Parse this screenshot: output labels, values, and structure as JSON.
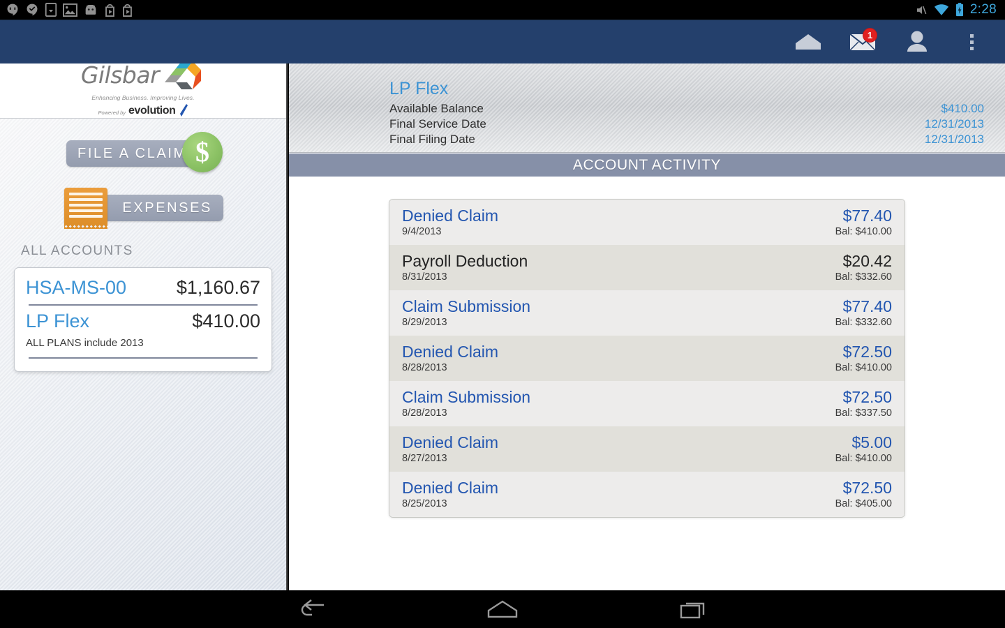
{
  "statusbar": {
    "clock": "2:28",
    "left_icons": [
      "hangouts-icon",
      "checkmark-message-icon",
      "download-icon",
      "photo-icon",
      "android-head-icon",
      "play-store-icon",
      "play-store-icon-2"
    ],
    "right_icons": [
      "mute-icon",
      "wifi-icon",
      "battery-charging-icon"
    ]
  },
  "appbar": {
    "background": "#24406c",
    "home_label": "home-icon",
    "messages_label": "messages-icon",
    "message_badge": "1",
    "profile_label": "profile-icon",
    "overflow_label": "overflow-menu-icon"
  },
  "sidebar": {
    "logo": {
      "brand": "Gilsbar",
      "tagline": "Enhancing Business. Improving Lives.",
      "powered_by": "Powered by",
      "platform": "evolution"
    },
    "file_claim_label": "FILE A CLAIM",
    "expenses_label": "EXPENSES",
    "all_accounts_label": "ALL ACCOUNTS",
    "accounts": [
      {
        "name": "HSA-MS-00",
        "balance": "$1,160.67"
      },
      {
        "name": "LP Flex",
        "balance": "$410.00"
      }
    ],
    "accounts_note": "ALL PLANS include 2013"
  },
  "account_header": {
    "title": "LP Flex",
    "rows": [
      {
        "label": "Available Balance",
        "value": "$410.00"
      },
      {
        "label": "Final Service Date",
        "value": "12/31/2013"
      },
      {
        "label": "Final Filing Date",
        "value": "12/31/2013"
      }
    ]
  },
  "activity": {
    "section_title": "ACCOUNT ACTIVITY",
    "transactions": [
      {
        "name": "Denied Claim",
        "date": "9/4/2013",
        "amount": "$77.40",
        "balance": "Bal: $410.00",
        "highlight": "blue"
      },
      {
        "name": "Payroll Deduction",
        "date": "8/31/2013",
        "amount": "$20.42",
        "balance": "Bal: $332.60",
        "highlight": "dark"
      },
      {
        "name": "Claim Submission",
        "date": "8/29/2013",
        "amount": "$77.40",
        "balance": "Bal: $332.60",
        "highlight": "blue"
      },
      {
        "name": "Denied Claim",
        "date": "8/28/2013",
        "amount": "$72.50",
        "balance": "Bal: $410.00",
        "highlight": "blue"
      },
      {
        "name": "Claim Submission",
        "date": "8/28/2013",
        "amount": "$72.50",
        "balance": "Bal: $337.50",
        "highlight": "blue"
      },
      {
        "name": "Denied Claim",
        "date": "8/27/2013",
        "amount": "$5.00",
        "balance": "Bal: $410.00",
        "highlight": "blue"
      },
      {
        "name": "Denied Claim",
        "date": "8/25/2013",
        "amount": "$72.50",
        "balance": "Bal: $405.00",
        "highlight": "blue"
      }
    ]
  },
  "navbar": {
    "back_label": "back-icon",
    "home_label": "home-icon",
    "recents_label": "recent-apps-icon"
  },
  "colors": {
    "appbar_blue": "#24406c",
    "link_blue": "#3c93d4",
    "txn_blue": "#2356b0",
    "activity_bar": "#8690a8",
    "coin_green": "#8cc265",
    "receipt_orange": "#de8f2a",
    "badge_red": "#e02020"
  }
}
